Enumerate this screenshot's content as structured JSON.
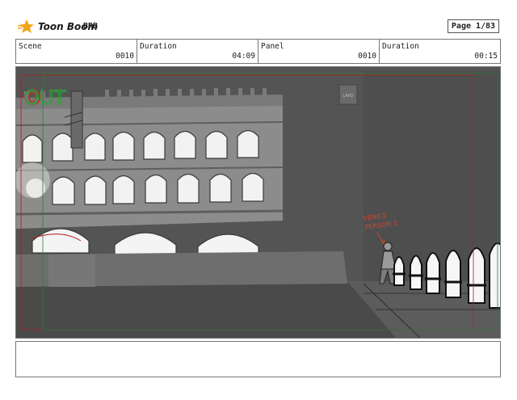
{
  "header": {
    "brand": "Toon Boom",
    "project": "BRB",
    "page_label": "Page",
    "page_value": "1/83"
  },
  "info": {
    "scene_label": "Scene",
    "scene_value": "0010",
    "scene_duration_label": "Duration",
    "scene_duration_value": "04:09",
    "panel_label": "Panel",
    "panel_value": "0010",
    "panel_duration_label": "Duration",
    "panel_duration_value": "00:15"
  },
  "panel": {
    "out_text": "OUT",
    "small_sign": "LAPD",
    "annotation_line1": "VENICE",
    "annotation_line2": "PERSON 3"
  },
  "colors": {
    "out_red": "#d81e1e",
    "out_green": "#2aa43a",
    "annotation_red": "#d8452a",
    "guide_red": "#b02020",
    "guide_green": "#2f7a3a"
  }
}
